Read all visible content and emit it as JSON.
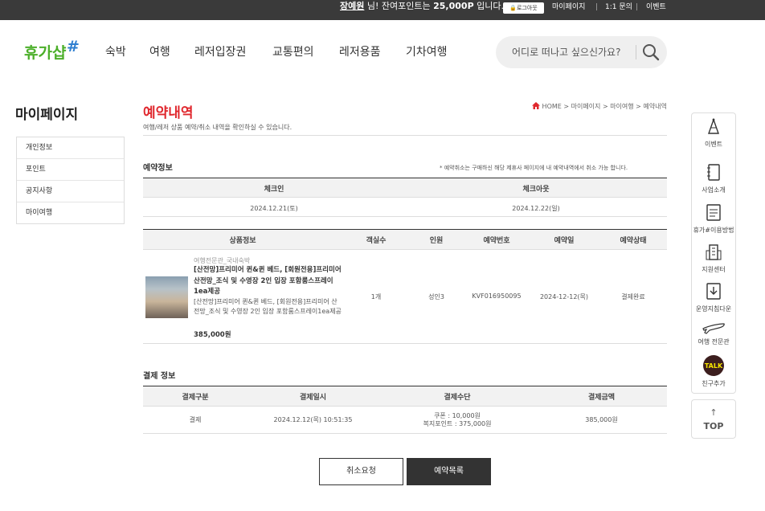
{
  "topbar": {
    "user_name": "장예원",
    "welcome_mid": " 님! 잔여포인트는 ",
    "points": "25,000P",
    "welcome_end": " 입니다.",
    "logout_label": "로그아웃",
    "links": [
      "마이페이지",
      "1:1 문의",
      "이벤트"
    ]
  },
  "logo": {
    "text": "휴가샵",
    "accent": "#4caf2a"
  },
  "nav": [
    "숙박",
    "여행",
    "레저입장권",
    "교통편의",
    "레저용품",
    "기차여행"
  ],
  "search": {
    "placeholder": "어디로 떠나고 싶으신가요?",
    "icon": "search-icon"
  },
  "sidebar": {
    "title": "마이페이지",
    "items": [
      "개인정보",
      "포인트",
      "공지사항",
      "마이여행"
    ]
  },
  "page": {
    "title": "예약내역",
    "description": "여행/레저 상품 예약/취소 내역을 확인하실 수 있습니다.",
    "breadcrumb": "HOME > 마이페이지 > 마이여행 > 예약내역"
  },
  "reservation": {
    "section_title": "예약정보",
    "note": "* 예약취소는 구매하신 해당 제휴사 페이지에 내 예약내역에서 취소 가능 합니다.",
    "checkin_label": "체크인",
    "checkout_label": "체크아웃",
    "checkin": "2024.12.21(토)",
    "checkout": "2024.12.22(일)"
  },
  "product_table": {
    "headers": [
      "상품정보",
      "객실수",
      "인원",
      "예약번호",
      "예약일",
      "예약상태"
    ],
    "row": {
      "category": "여행전문관_국내숙박",
      "name": "[산전망]프리미어 퀸&퀸 베드, [회원전용]프리미어 산전망_조식 및 수영장 2인 입장 포함룸스프레이1ea제공",
      "sub": "[산전망]프리미어 퀸&퀸 베드, [회원전용]프리미어 산전망_조식 및 수영장 2인 입장 포함룸스프레이1ea제공",
      "price": "385,000원",
      "rooms": "1개",
      "people": "성인3",
      "reservation_no": "KVF016950095",
      "reserved_date": "2024-12-12(목)",
      "status": "결제완료"
    }
  },
  "payment": {
    "section_title": "결제 정보",
    "headers": [
      "결제구분",
      "결제일시",
      "결제수단",
      "결제금액"
    ],
    "row": {
      "type": "결제",
      "datetime": "2024.12.12(목) 10:51:35",
      "method_line1": "쿠폰 : 10,000원",
      "method_line2": "복지포인트 : 375,000원",
      "amount": "385,000원"
    }
  },
  "buttons": {
    "cancel": "취소요청",
    "list": "예약목록"
  },
  "quick_menu": {
    "items": [
      "이벤트",
      "사업소개",
      "휴가#이용방법",
      "지원센터",
      "운영지침다운",
      "여행 전문관",
      "친구추가"
    ],
    "kakao_badge": "TALK",
    "top_label": "TOP"
  },
  "colors": {
    "accent_red": "#e0282e",
    "topbar_bg": "#3a3a3a",
    "kakao": "#3c1e1e",
    "kakao_bg": "#f7e600"
  }
}
